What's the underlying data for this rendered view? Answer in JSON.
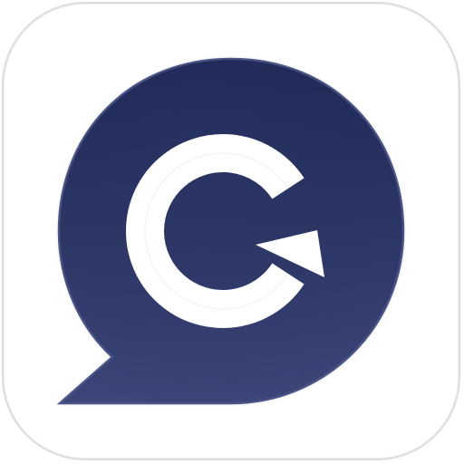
{
  "icon": {
    "name": "app-icon",
    "shape": "speech-bubble",
    "glyph": "G-with-circular-arrow",
    "colors": {
      "tile_background": "#ffffff",
      "tile_border": "#dcdcdc",
      "bubble_top": "#202a58",
      "bubble_bottom": "#3c4678",
      "bubble_edge": "#4a5485",
      "glyph": "#ffffff"
    }
  }
}
